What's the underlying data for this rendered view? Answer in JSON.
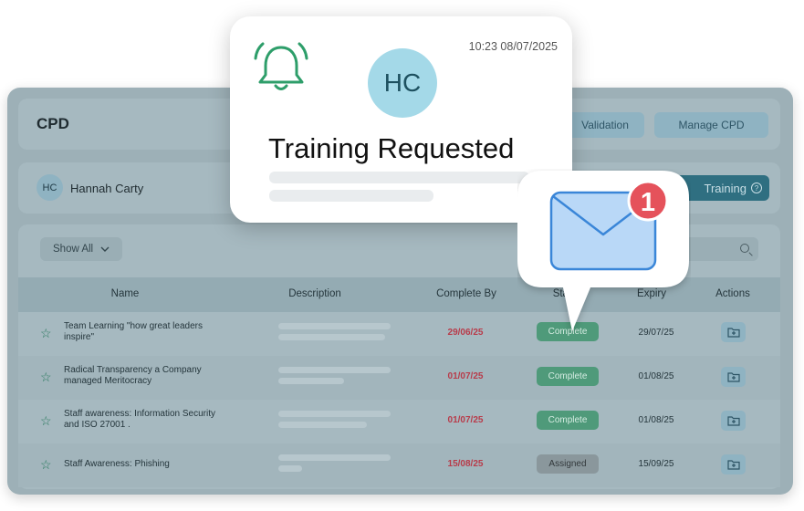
{
  "header": {
    "title": "CPD",
    "validation_label": "Validation",
    "manage_label": "Manage CPD"
  },
  "user": {
    "initials": "HC",
    "name": "Hannah Carty",
    "training_label": "Training"
  },
  "filters": {
    "show_all_label": "Show All"
  },
  "table": {
    "columns": [
      "Name",
      "Description",
      "Complete By",
      "Status",
      "Expiry",
      "Actions"
    ],
    "rows": [
      {
        "name": "Team Learning \"how great leaders inspire\"",
        "complete_by": "29/06/25",
        "status": "Complete",
        "expiry": "29/07/25"
      },
      {
        "name": "Radical Transparency a Company managed Meritocracy",
        "complete_by": "01/07/25",
        "status": "Complete",
        "expiry": "01/08/25"
      },
      {
        "name": "Staff awareness: Information Security and ISO 27001 .",
        "complete_by": "01/07/25",
        "status": "Complete",
        "expiry": "01/08/25"
      },
      {
        "name": "Staff Awareness: Phishing",
        "complete_by": "15/08/25",
        "status": "Assigned",
        "expiry": "15/09/25"
      }
    ]
  },
  "notification": {
    "time": "10:23 08/07/2025",
    "initials": "HC",
    "title": "Training Requested",
    "icon": "bell-icon"
  },
  "mail_badge": {
    "count": "1",
    "icon": "envelope-icon"
  },
  "colors": {
    "accent_green": "#2e9e6a",
    "badge_red": "#e5525b",
    "complete_due": "#b83b4a"
  }
}
